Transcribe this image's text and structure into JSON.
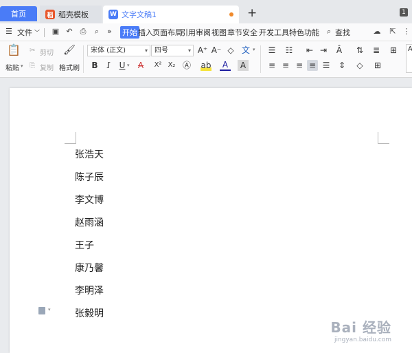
{
  "tabs": {
    "home": "首页",
    "template": "稻壳模板",
    "document": "文字文稿1",
    "add_symbol": "+",
    "window_count": "1"
  },
  "menu": {
    "file": "文件",
    "items": [
      "开始",
      "插入",
      "页面布局",
      "引用",
      "审阅",
      "视图",
      "章节",
      "安全",
      "开发工具",
      "特色功能"
    ],
    "more": "»",
    "search": "查找"
  },
  "ribbon": {
    "paste": "粘贴",
    "cut": "剪切",
    "copy": "复制",
    "format_painter": "格式刷",
    "font_name": "宋体 (正文)",
    "font_size": "四号",
    "bold": "B",
    "italic": "I",
    "underline": "U",
    "strike": "A",
    "superscript": "X²",
    "subscript": "X₂",
    "font_color": "A",
    "char_shade": "A",
    "grow_font": "A⁺",
    "shrink_font": "A⁻",
    "clear_format": "◇",
    "pinyin": "文",
    "accent_color": "#4a7cf7"
  },
  "document": {
    "lines": [
      "张浩天",
      "陈子辰",
      "李文博",
      "赵雨涵",
      "王子",
      "康乃馨",
      "李明泽",
      "张毅明"
    ]
  },
  "watermark": {
    "main": "Bai 经验",
    "sub": "jingyan.baidu.com"
  }
}
